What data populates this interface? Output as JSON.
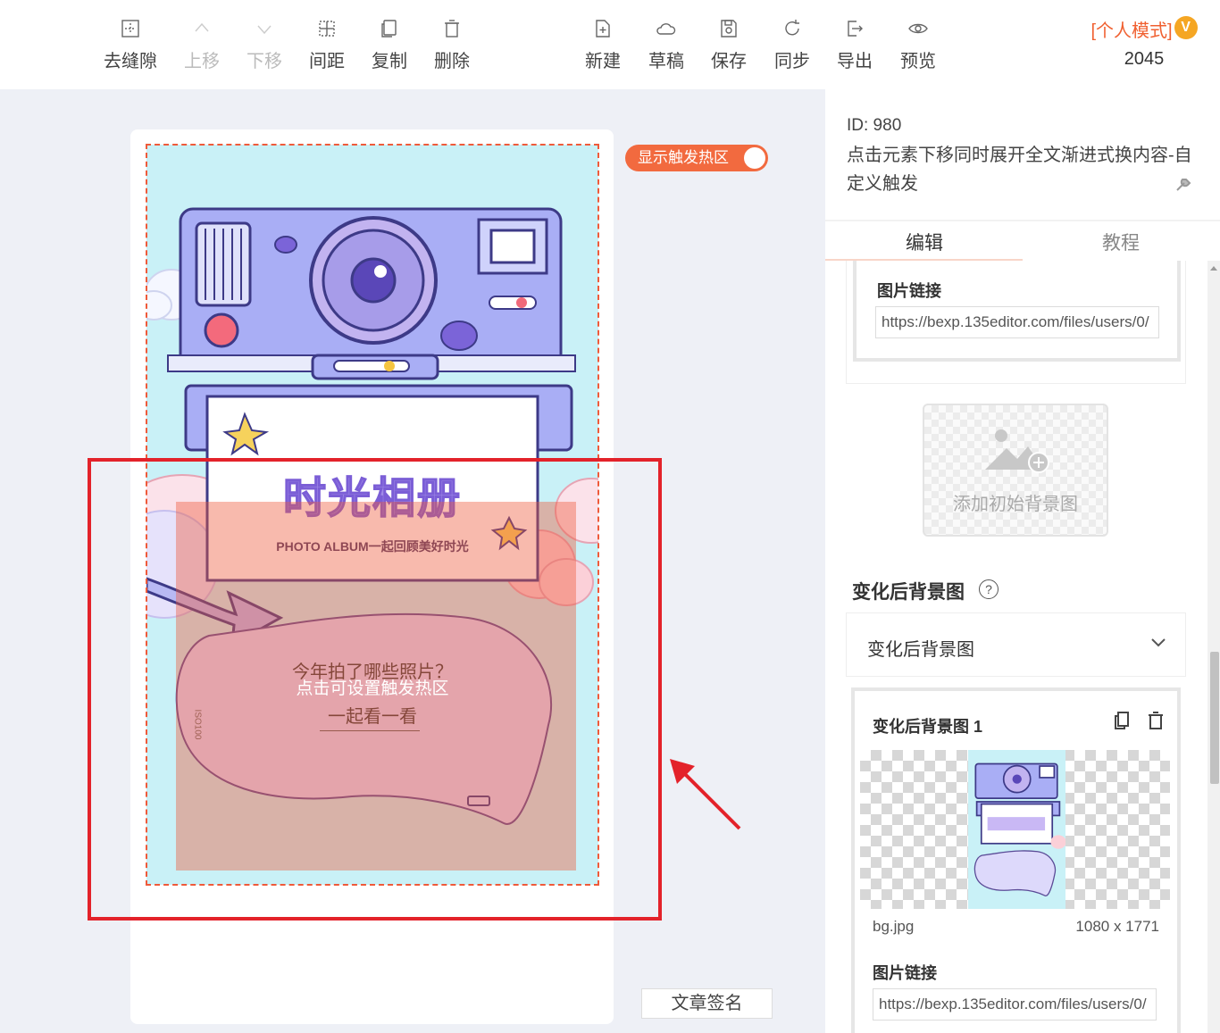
{
  "toolbar": {
    "left": [
      {
        "label": "去缝隙",
        "icon": "gap-icon",
        "disabled": false
      },
      {
        "label": "上移",
        "icon": "up-chevron-icon",
        "disabled": true
      },
      {
        "label": "下移",
        "icon": "down-chevron-icon",
        "disabled": true
      },
      {
        "label": "间距",
        "icon": "spacing-icon",
        "disabled": false
      },
      {
        "label": "复制",
        "icon": "copy-icon",
        "disabled": false
      },
      {
        "label": "删除",
        "icon": "trash-icon",
        "disabled": false
      }
    ],
    "right": [
      {
        "label": "新建",
        "icon": "new-doc-icon"
      },
      {
        "label": "草稿",
        "icon": "cloud-icon"
      },
      {
        "label": "保存",
        "icon": "save-icon"
      },
      {
        "label": "同步",
        "icon": "sync-icon"
      },
      {
        "label": "导出",
        "icon": "export-icon"
      },
      {
        "label": "预览",
        "icon": "eye-icon"
      }
    ],
    "mode_label": "[个人模式]",
    "vip_badge": "V",
    "count": "2045"
  },
  "canvas": {
    "toggle_label": "显示触发热区",
    "signature_button": "文章签名",
    "poster": {
      "title": "时光相册",
      "subtitle": "PHOTO ALBUM一起回顾美好时光",
      "question": "今年拍了哪些照片？",
      "hotzone_hint": "点击可设置触发热区",
      "look": "一起看一看",
      "iso": "ISO100"
    }
  },
  "panel": {
    "id_text": "ID: 980",
    "description": "点击元素下移同时展开全文渐进式换内容-自定义触发",
    "tabs": [
      "编辑",
      "教程"
    ],
    "image_link_label": "图片链接",
    "image_link_value": "https://bexp.135editor.com/files/users/0/",
    "add_initial_bg": "添加初始背景图",
    "after_bg_section_title": "变化后背景图",
    "after_bg_select_value": "变化后背景图",
    "after_bg_card_title": "变化后背景图 1",
    "file_name": "bg.jpg",
    "file_size": "1080 x 1771",
    "image_link_label_2": "图片链接",
    "image_link_value_2": "https://bexp.135editor.com/files/users/0/"
  },
  "colors": {
    "accent": "#f26a3f",
    "frame_red": "#e3222a",
    "poster_bg": "#c9f1f7",
    "camera_purple": "#a9aef5"
  }
}
